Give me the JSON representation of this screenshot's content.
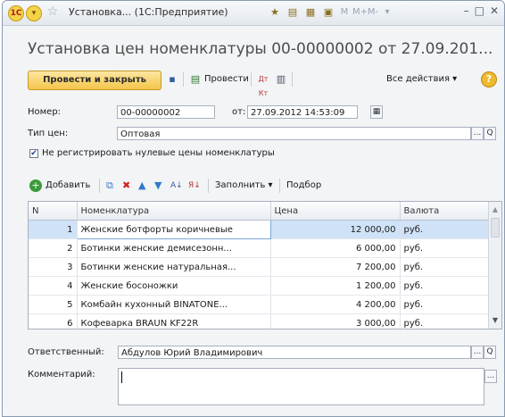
{
  "window": {
    "title": "Установка... (1С:Предприятие)",
    "logo_text": "1С",
    "tool_m": "M",
    "tool_mplus": "M+",
    "tool_mminus": "M-"
  },
  "form": {
    "title": "Установка цен номенклатуры 00-00000002 от 27.09.201..."
  },
  "commandbar": {
    "post_close_label": "Провести и закрыть",
    "post_label": "Провести",
    "dt_kt_label": "Дт Кт",
    "all_actions_label": "Все действия ▾",
    "help_label": "?"
  },
  "fields": {
    "number_label": "Номер:",
    "number_value": "00-00000002",
    "date_label": "от:",
    "date_value": "27.09.2012 14:53:09",
    "price_type_label": "Тип цен:",
    "price_type_value": "Оптовая",
    "skip_zero_label": "Не регистрировать нулевые цены номенклатуры",
    "skip_zero_checked": true,
    "responsible_label": "Ответственный:",
    "responsible_value": "Абдулов Юрий Владимирович",
    "comment_label": "Комментарий:",
    "comment_value": "",
    "select_btn": "...",
    "open_btn": "Q"
  },
  "table_toolbar": {
    "add_label": "Добавить",
    "fill_label": "Заполнить ▾",
    "pick_label": "Подбор"
  },
  "table": {
    "columns": [
      "N",
      "Номенклатура",
      "Цена",
      "Валюта"
    ],
    "rows": [
      {
        "n": "1",
        "item": "Женские ботфорты коричневые",
        "price": "12 000,00",
        "currency": "руб."
      },
      {
        "n": "2",
        "item": "Ботинки женские демисезонн...",
        "price": "6 000,00",
        "currency": "руб."
      },
      {
        "n": "3",
        "item": "Ботинки женские натуральная...",
        "price": "7 200,00",
        "currency": "руб."
      },
      {
        "n": "4",
        "item": "Женские босоножки",
        "price": "1 200,00",
        "currency": "руб."
      },
      {
        "n": "5",
        "item": "Комбайн кухонный BINATONE...",
        "price": "4 200,00",
        "currency": "руб."
      },
      {
        "n": "6",
        "item": "Кофеварка BRAUN KF22R",
        "price": "3 000,00",
        "currency": "руб."
      }
    ]
  },
  "colors": {
    "accent": "#f4c54a",
    "selection": "#cfe2f7",
    "border": "#a7b0bd"
  }
}
